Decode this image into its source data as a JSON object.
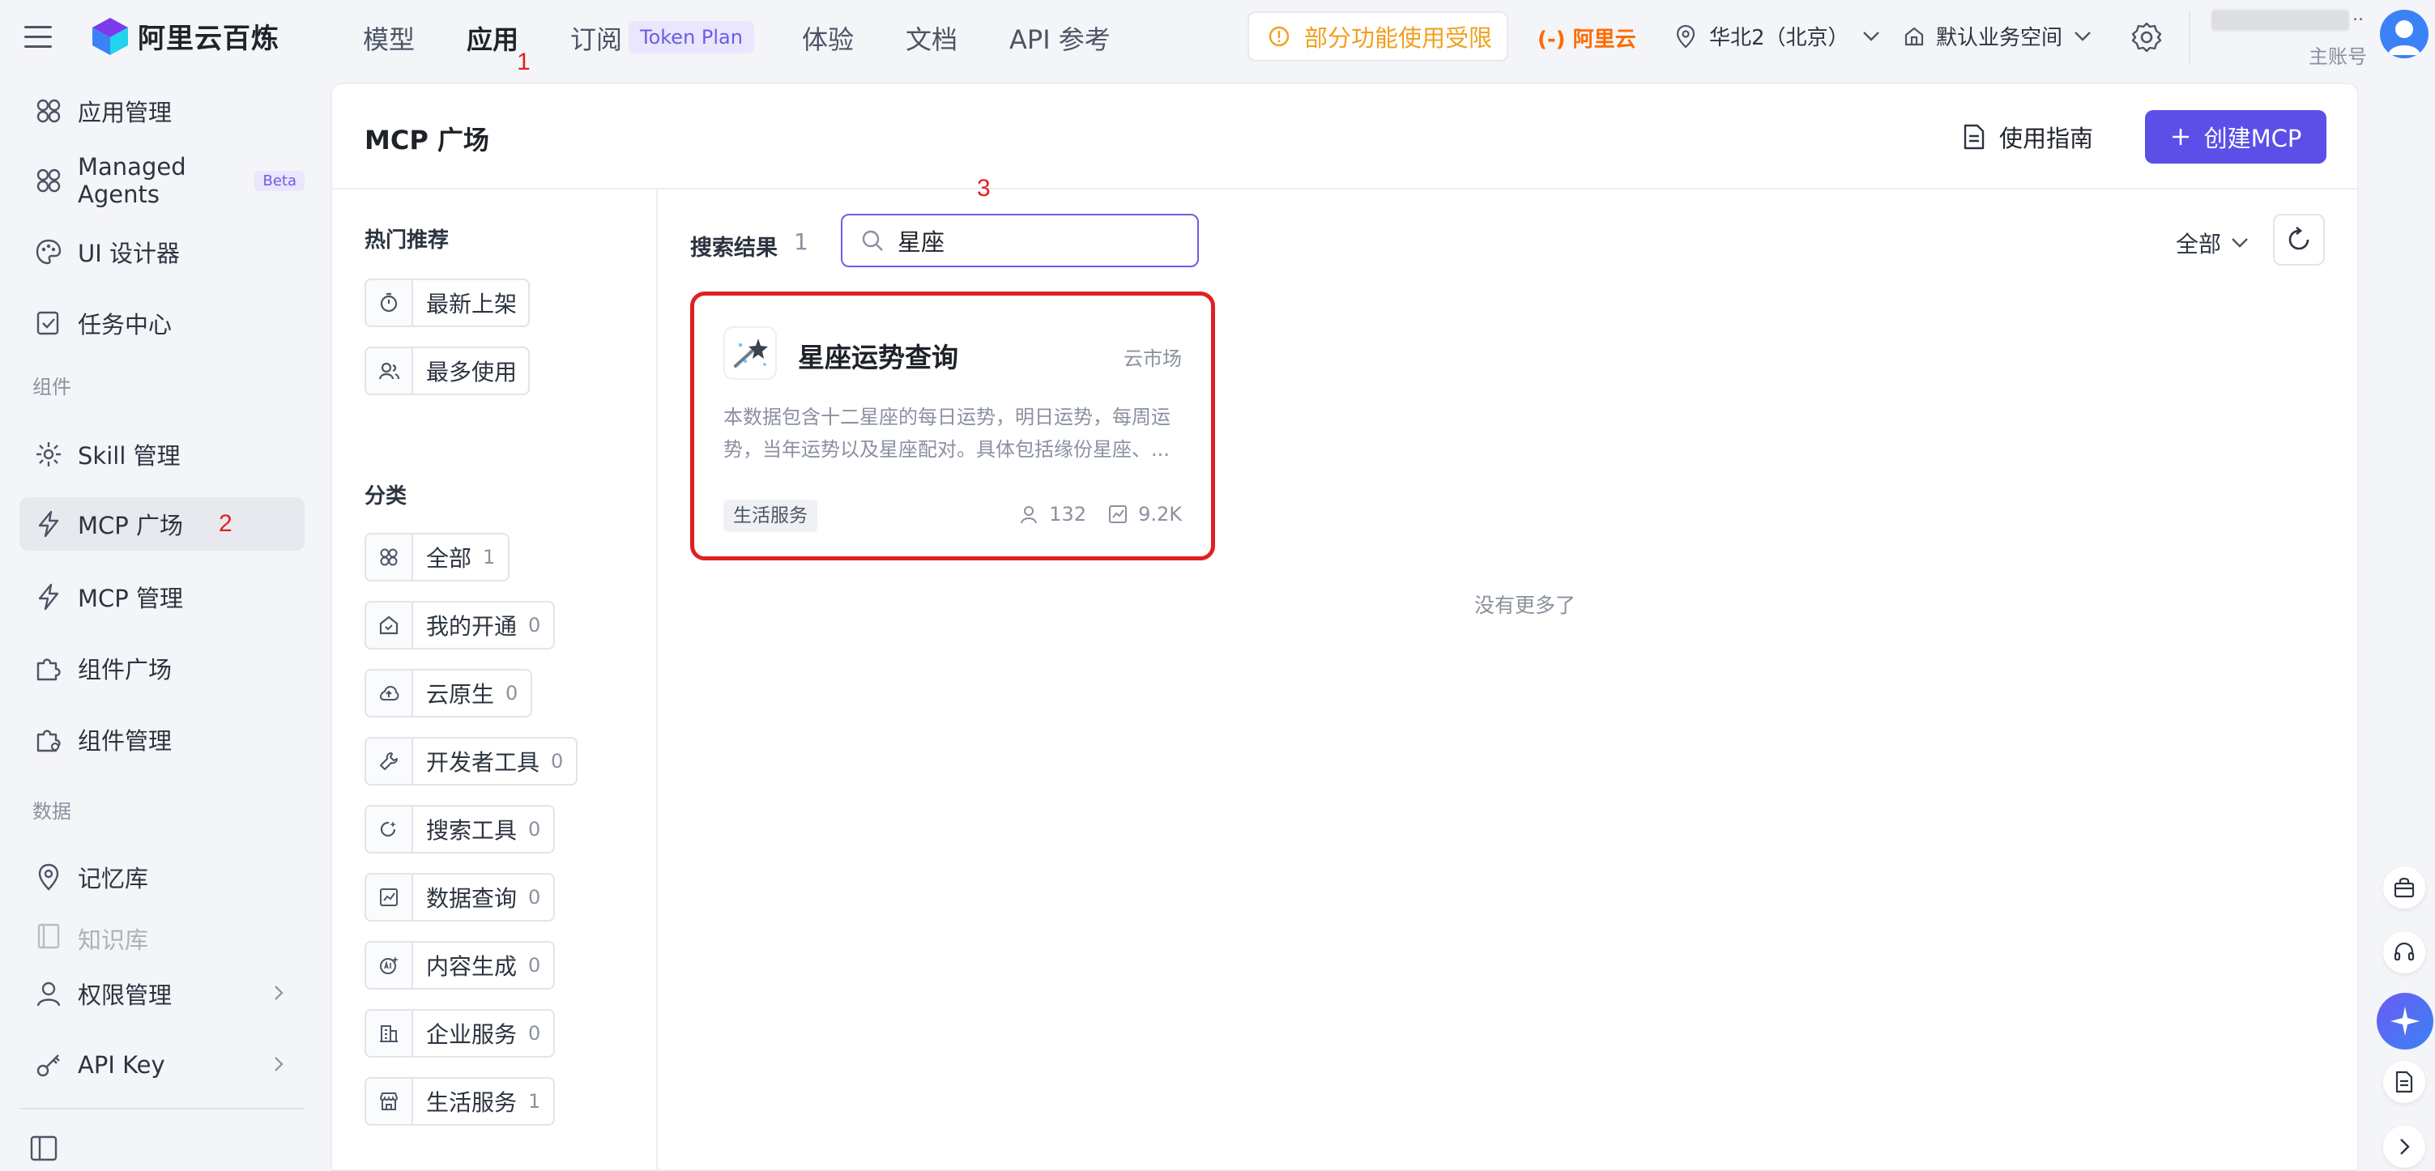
{
  "topbar": {
    "brand": "阿里云百炼",
    "nav": [
      {
        "label": "模型"
      },
      {
        "label": "应用"
      },
      {
        "label": "订阅"
      },
      {
        "label": "体验"
      },
      {
        "label": "文档"
      },
      {
        "label": "API 参考"
      }
    ],
    "token_badge": "Token Plan",
    "warning": "部分功能使用受限",
    "aliyun_logo": "(-) 阿里云",
    "region": "华北2（北京）",
    "workspace": "默认业务空间",
    "account_label": "主账号",
    "account_dots": ".."
  },
  "annotations": {
    "n1": "1",
    "n2": "2",
    "n3": "3"
  },
  "sidebar": {
    "items": [
      {
        "label": "应用管理"
      },
      {
        "label": "Managed Agents",
        "badge": "Beta"
      },
      {
        "label": "UI 设计器"
      },
      {
        "label": "任务中心"
      },
      {
        "label": "Skill 管理"
      },
      {
        "label": "MCP 广场"
      },
      {
        "label": "MCP 管理"
      },
      {
        "label": "组件广场"
      },
      {
        "label": "组件管理"
      },
      {
        "label": "记忆库"
      },
      {
        "label": "知识库"
      },
      {
        "label": "权限管理"
      },
      {
        "label": "API Key"
      }
    ],
    "groups": {
      "components": "组件",
      "data": "数据"
    }
  },
  "main": {
    "title": "MCP 广场",
    "guide_label": "使用指南",
    "create_label": "创建MCP"
  },
  "filters": {
    "hot_title": "热门推荐",
    "hot": [
      {
        "label": "最新上架"
      },
      {
        "label": "最多使用"
      }
    ],
    "category_title": "分类",
    "categories": [
      {
        "label": "全部",
        "count": "1"
      },
      {
        "label": "我的开通",
        "count": "0"
      },
      {
        "label": "云原生",
        "count": "0"
      },
      {
        "label": "开发者工具",
        "count": "0"
      },
      {
        "label": "搜索工具",
        "count": "0"
      },
      {
        "label": "数据查询",
        "count": "0"
      },
      {
        "label": "内容生成",
        "count": "0"
      },
      {
        "label": "企业服务",
        "count": "0"
      },
      {
        "label": "生活服务",
        "count": "1"
      }
    ]
  },
  "results": {
    "label": "搜索结果",
    "count": "1",
    "search_value": "星座",
    "filter_value": "全部",
    "no_more": "没有更多了",
    "cards": [
      {
        "title": "星座运势查询",
        "source": "云市场",
        "description": "本数据包含十二星座的每日运势，明日运势，每周运势，当年运势以及星座配对。具体包括缘份星座、...",
        "tag": "生活服务",
        "users": "132",
        "calls": "9.2K"
      }
    ]
  },
  "colors": {
    "accent": "#5b4fe8",
    "highlight": "#e02020",
    "warning": "#f0a020",
    "aliyun": "#ff6a00"
  }
}
